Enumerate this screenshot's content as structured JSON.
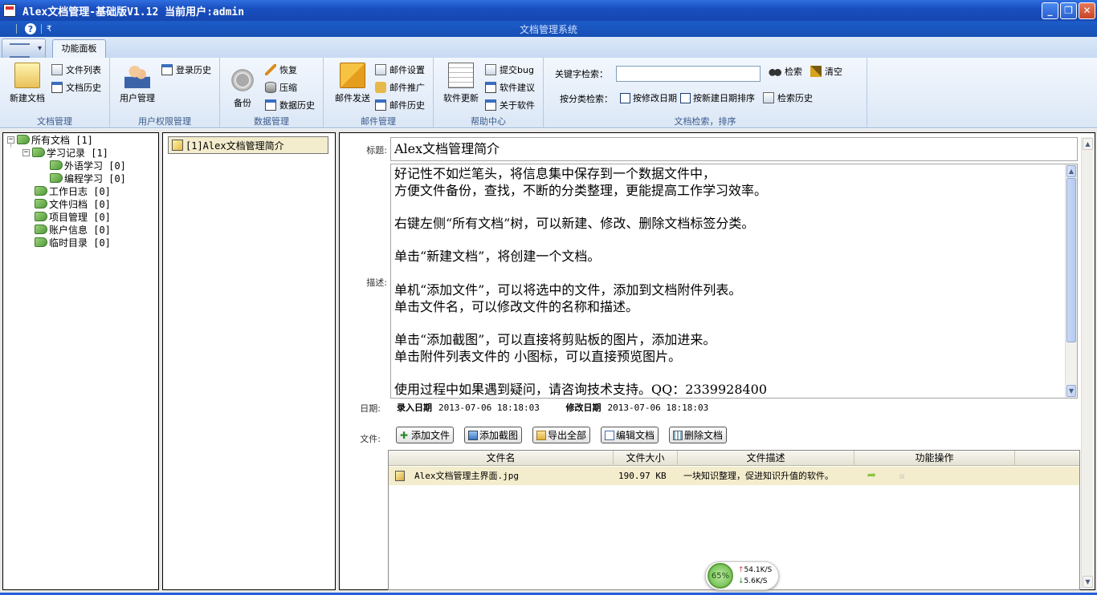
{
  "window": {
    "title": "Alex文档管理-基础版V1.12 当前用户:admin",
    "subtitle": "文档管理系统",
    "minimize": "_",
    "maximize": "❐",
    "close": "✕"
  },
  "qat": {
    "help": "?",
    "dropdown": "₹"
  },
  "ribbon": {
    "tab": "功能面板",
    "groups": {
      "doc": {
        "label": "文档管理",
        "new_doc": "新建文档",
        "file_list": "文件列表",
        "doc_history": "文档历史"
      },
      "user": {
        "label": "用户权限管理",
        "user_mgmt": "用户管理",
        "login_history": "登录历史"
      },
      "data": {
        "label": "数据管理",
        "backup": "备份",
        "restore": "恢复",
        "compress": "压缩",
        "data_history": "数据历史"
      },
      "mail": {
        "label": "邮件管理",
        "send": "邮件发送",
        "settings": "邮件设置",
        "promote": "邮件推广",
        "history": "邮件历史"
      },
      "help": {
        "label": "帮助中心",
        "update": "软件更新",
        "submit_bug": "提交bug",
        "suggest": "软件建议",
        "about": "关于软件"
      },
      "search": {
        "label": "文档检索，排序",
        "keyword_label": "关键字检索：",
        "keyword_value": "",
        "search_btn": "检索",
        "clear_btn": "清空",
        "category_label": "按分类检索：",
        "by_modified": "按修改日期",
        "by_created": "按新建日期排序",
        "search_history": "检索历史"
      }
    }
  },
  "tree": {
    "root": "所有文档 [1]",
    "study": "学习记录 [1]",
    "lang": "外语学习 [0]",
    "prog": "编程学习 [0]",
    "worklog": "工作日志 [0]",
    "archive": "文件归档 [0]",
    "project": "项目管理 [0]",
    "account": "账户信息 [0]",
    "temp": "临时目录 [0]"
  },
  "doclist": {
    "item": "[1]Alex文档管理简介"
  },
  "detail": {
    "title_label": "标题:",
    "title_value": "Alex文档管理简介",
    "desc_label": "描述:",
    "desc_lines": [
      "好记性不如烂笔头，将信息集中保存到一个数据文件中，",
      "方便文件备份，查找，不断的分类整理，更能提高工作学习效率。",
      "",
      "右键左侧“所有文档”树，可以新建、修改、删除文档标签分类。",
      "",
      "单击“新建文档”，将创建一个文档。",
      "",
      "单机“添加文件”，可以将选中的文件，添加到文档附件列表。",
      "单击文件名，可以修改文件的名称和描述。",
      "",
      "单击“添加截图”，可以直接将剪贴板的图片，添加进来。",
      "单击附件列表文件的 小图标，可以直接预览图片。",
      "",
      "使用过程中如果遇到疑问，请咨询技术支持。QQ：2339928400"
    ],
    "date_label": "日期:",
    "created_label": "录入日期",
    "created_value": "2013-07-06 18:18:03",
    "modified_label": "修改日期",
    "modified_value": "2013-07-06 18:18:03",
    "file_label": "文件:",
    "buttons": {
      "add_file": "添加文件",
      "add_screenshot": "添加截图",
      "export_all": "导出全部",
      "edit_doc": "编辑文档",
      "delete_doc": "删除文档"
    },
    "table": {
      "headers": [
        "文件名",
        "文件大小",
        "文件描述",
        "功能操作"
      ],
      "rows": [
        {
          "name": "Alex文档管理主界面.jpg",
          "size": "190.97 KB",
          "desc": "一块知识整理，促进知识升值的软件。"
        }
      ]
    }
  },
  "net": {
    "percent": "65%",
    "up": "54.1K/S",
    "down": "5.6K/S"
  },
  "colors": {
    "titlebar": "#1a4fc0",
    "selected_row": "#f3eccd"
  }
}
